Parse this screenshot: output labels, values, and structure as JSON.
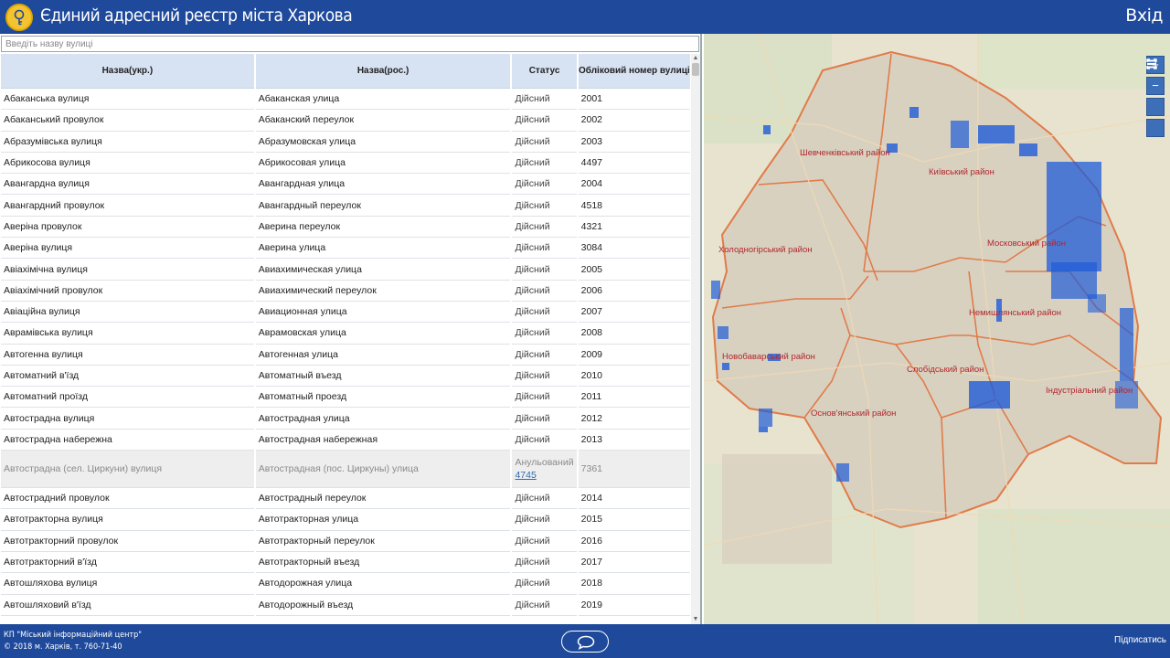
{
  "header": {
    "title": "Єдиний адресний реєстр міста Харкова",
    "login_label": "Вхід",
    "logo_icon": "city-key-emblem"
  },
  "search": {
    "placeholder": "Введіть назву вулиці"
  },
  "table": {
    "columns": [
      "Назва(укр.)",
      "Назва(рос.)",
      "Статус",
      "Обліковий номер вулиці"
    ],
    "rows": [
      {
        "ukr": "Абаканська вулиця",
        "rus": "Абаканская улица",
        "status": "Дійсний",
        "num": "2001"
      },
      {
        "ukr": "Абаканський провулок",
        "rus": "Абаканский переулок",
        "status": "Дійсний",
        "num": "2002"
      },
      {
        "ukr": "Абразумівська вулиця",
        "rus": "Абразумовская улица",
        "status": "Дійсний",
        "num": "2003"
      },
      {
        "ukr": "Абрикосова вулиця",
        "rus": "Абрикосовая улица",
        "status": "Дійсний",
        "num": "4497"
      },
      {
        "ukr": "Авангардна вулиця",
        "rus": "Авангардная улица",
        "status": "Дійсний",
        "num": "2004"
      },
      {
        "ukr": "Авангардний провулок",
        "rus": "Авангардный переулок",
        "status": "Дійсний",
        "num": "4518"
      },
      {
        "ukr": "Аверіна провулок",
        "rus": "Аверина переулок",
        "status": "Дійсний",
        "num": "4321"
      },
      {
        "ukr": "Аверіна вулиця",
        "rus": "Аверина улица",
        "status": "Дійсний",
        "num": "3084"
      },
      {
        "ukr": "Авіахімічна вулиця",
        "rus": "Авиахимическая улица",
        "status": "Дійсний",
        "num": "2005"
      },
      {
        "ukr": "Авіахімічний провулок",
        "rus": "Авиахимический переулок",
        "status": "Дійсний",
        "num": "2006"
      },
      {
        "ukr": "Авіаційна вулиця",
        "rus": "Авиационная улица",
        "status": "Дійсний",
        "num": "2007"
      },
      {
        "ukr": "Аврамівська вулиця",
        "rus": "Аврамовская улица",
        "status": "Дійсний",
        "num": "2008"
      },
      {
        "ukr": "Автогенна вулиця",
        "rus": "Автогенная улица",
        "status": "Дійсний",
        "num": "2009"
      },
      {
        "ukr": "Автоматний в'їзд",
        "rus": "Автоматный въезд",
        "status": "Дійсний",
        "num": "2010"
      },
      {
        "ukr": "Автоматний проїзд",
        "rus": "Автоматный проезд",
        "status": "Дійсний",
        "num": "2011"
      },
      {
        "ukr": "Автострадна вулиця",
        "rus": "Автострадная улица",
        "status": "Дійсний",
        "num": "2012"
      },
      {
        "ukr": "Автострадна набережна",
        "rus": "Автострадная набережная",
        "status": "Дійсний",
        "num": "2013"
      }
    ],
    "cancelled_row": {
      "ukr": "Автострадна (сел. Циркуни) вулиця",
      "rus": "Автострадная (пос. Циркуны) улица",
      "status": "Анульований",
      "link": "4745",
      "num": "7361"
    },
    "rows_after": [
      {
        "ukr": "Автострадний провулок",
        "rus": "Автострадный переулок",
        "status": "Дійсний",
        "num": "2014"
      },
      {
        "ukr": "Автотракторна вулиця",
        "rus": "Автотракторная улица",
        "status": "Дійсний",
        "num": "2015"
      },
      {
        "ukr": "Автотракторний провулок",
        "rus": "Автотракторный переулок",
        "status": "Дійсний",
        "num": "2016"
      },
      {
        "ukr": "Автотракторний в'їзд",
        "rus": "Автотракторный въезд",
        "status": "Дійсний",
        "num": "2017"
      },
      {
        "ukr": "Автошляхова вулиця",
        "rus": "Автодорожная улица",
        "status": "Дійсний",
        "num": "2018"
      },
      {
        "ukr": "Автошляховий в'їзд",
        "rus": "Автодорожный въезд",
        "status": "Дійсний",
        "num": "2019"
      }
    ]
  },
  "map": {
    "districts": [
      {
        "name": "Шевченківський район"
      },
      {
        "name": "Київський район"
      },
      {
        "name": "Холодногірський район"
      },
      {
        "name": "Московський район"
      },
      {
        "name": "Немишлянський район"
      },
      {
        "name": "Новобаварський район"
      },
      {
        "name": "Слобідський район"
      },
      {
        "name": "Індустріальний район"
      },
      {
        "name": "Основ'янський район"
      }
    ],
    "controls": [
      {
        "name": "zoom-in-button",
        "glyph": "+"
      },
      {
        "name": "zoom-out-button",
        "glyph": "−"
      },
      {
        "name": "full-extent-button",
        "glyph": "⛶"
      },
      {
        "name": "layers-button",
        "glyph": "☰"
      }
    ]
  },
  "footer": {
    "org_line1": "КП \"Міський інформаційний центр\"",
    "org_line2": "© 2018 м. Харків, т. 760-71-40",
    "subscribe_label": "Підписатись",
    "chat_icon": "chat-bubble-icon"
  },
  "colors": {
    "header_bg": "#1f4a9c",
    "table_header_bg": "#d7e2f2",
    "district_label": "#b0272f",
    "district_border": "#e07b4a",
    "highlight_blue": "#1e5bd8"
  }
}
